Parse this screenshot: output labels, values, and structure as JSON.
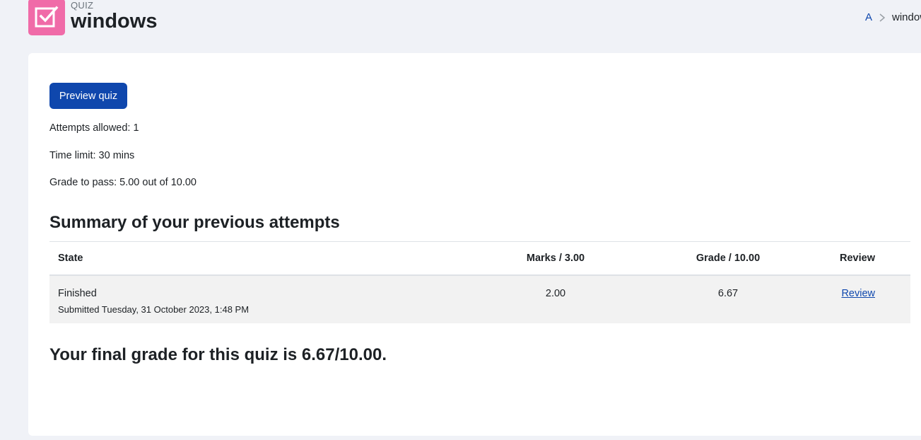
{
  "header": {
    "kind": "QUIZ",
    "title": "windows",
    "icon": "quiz-checkbox-icon",
    "icon_color": "#f06ba8"
  },
  "breadcrumb": {
    "items": [
      {
        "label": "A"
      },
      {
        "label": "windows"
      }
    ]
  },
  "main": {
    "preview_button": "Preview quiz",
    "info": {
      "attempts_allowed": "Attempts allowed: 1",
      "time_limit": "Time limit: 30 mins",
      "grade_to_pass": "Grade to pass: 5.00 out of 10.00"
    },
    "summary_heading": "Summary of your previous attempts",
    "table": {
      "columns": [
        "State",
        "Marks / 3.00",
        "Grade / 10.00",
        "Review"
      ],
      "rows": [
        {
          "state": "Finished",
          "submitted": "Submitted Tuesday, 31 October 2023, 1:48 PM",
          "marks": "2.00",
          "grade": "6.67",
          "review": "Review"
        }
      ]
    },
    "final_grade": "Your final grade for this quiz is 6.67/10.00."
  },
  "colors": {
    "accent": "#0f47ad",
    "background": "#f0f2f7",
    "card": "#ffffff"
  }
}
